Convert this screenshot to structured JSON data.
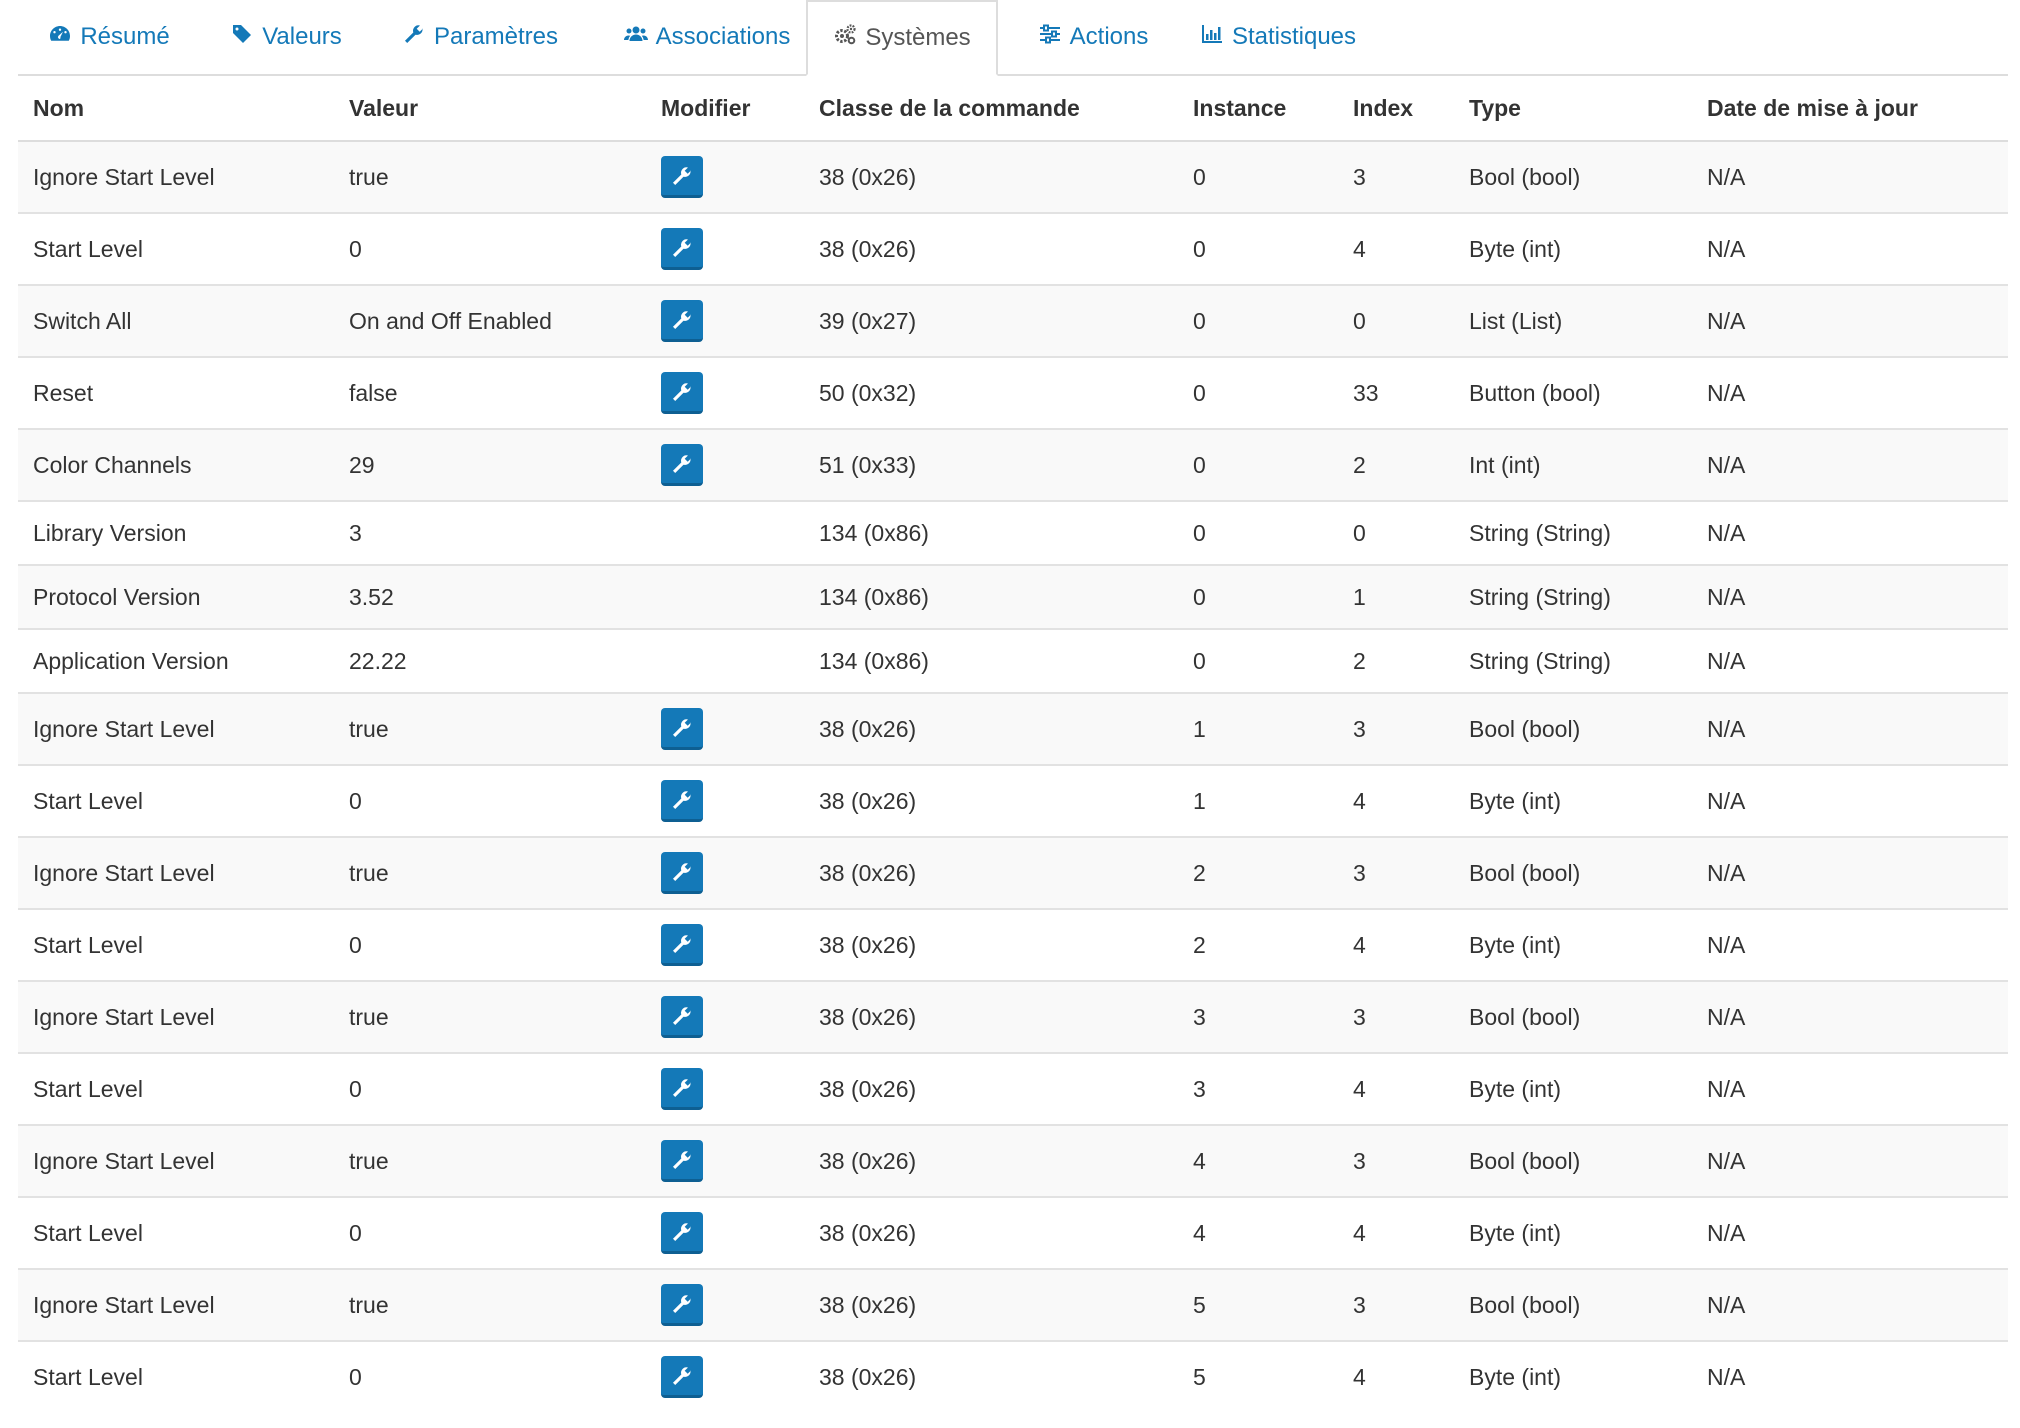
{
  "tabs": [
    {
      "label": "Résumé",
      "icon": "dashboard-icon"
    },
    {
      "label": "Valeurs",
      "icon": "tag-icon"
    },
    {
      "label": "Paramètres",
      "icon": "wrench-icon"
    },
    {
      "label": "Associations",
      "icon": "users-icon"
    },
    {
      "label": "Systèmes",
      "icon": "gears-icon",
      "active": true
    },
    {
      "label": "Actions",
      "icon": "sliders-icon"
    },
    {
      "label": "Statistiques",
      "icon": "bar-chart-icon"
    }
  ],
  "table": {
    "headers": [
      "Nom",
      "Valeur",
      "Modifier",
      "Classe de la commande",
      "Instance",
      "Index",
      "Type",
      "Date de mise à jour"
    ],
    "rows": [
      {
        "name": "Ignore Start Level",
        "value": "true",
        "editable": true,
        "cmd_class": "38 (0x26)",
        "instance": "0",
        "index": "3",
        "type": "Bool (bool)",
        "updated": "N/A"
      },
      {
        "name": "Start Level",
        "value": "0",
        "editable": true,
        "cmd_class": "38 (0x26)",
        "instance": "0",
        "index": "4",
        "type": "Byte (int)",
        "updated": "N/A"
      },
      {
        "name": "Switch All",
        "value": "On and Off Enabled",
        "editable": true,
        "cmd_class": "39 (0x27)",
        "instance": "0",
        "index": "0",
        "type": "List (List)",
        "updated": "N/A"
      },
      {
        "name": "Reset",
        "value": "false",
        "editable": true,
        "cmd_class": "50 (0x32)",
        "instance": "0",
        "index": "33",
        "type": "Button (bool)",
        "updated": "N/A"
      },
      {
        "name": "Color Channels",
        "value": "29",
        "editable": true,
        "cmd_class": "51 (0x33)",
        "instance": "0",
        "index": "2",
        "type": "Int (int)",
        "updated": "N/A"
      },
      {
        "name": "Library Version",
        "value": "3",
        "editable": false,
        "cmd_class": "134 (0x86)",
        "instance": "0",
        "index": "0",
        "type": "String (String)",
        "updated": "N/A"
      },
      {
        "name": "Protocol Version",
        "value": "3.52",
        "editable": false,
        "cmd_class": "134 (0x86)",
        "instance": "0",
        "index": "1",
        "type": "String (String)",
        "updated": "N/A"
      },
      {
        "name": "Application Version",
        "value": "22.22",
        "editable": false,
        "cmd_class": "134 (0x86)",
        "instance": "0",
        "index": "2",
        "type": "String (String)",
        "updated": "N/A"
      },
      {
        "name": "Ignore Start Level",
        "value": "true",
        "editable": true,
        "cmd_class": "38 (0x26)",
        "instance": "1",
        "index": "3",
        "type": "Bool (bool)",
        "updated": "N/A"
      },
      {
        "name": "Start Level",
        "value": "0",
        "editable": true,
        "cmd_class": "38 (0x26)",
        "instance": "1",
        "index": "4",
        "type": "Byte (int)",
        "updated": "N/A"
      },
      {
        "name": "Ignore Start Level",
        "value": "true",
        "editable": true,
        "cmd_class": "38 (0x26)",
        "instance": "2",
        "index": "3",
        "type": "Bool (bool)",
        "updated": "N/A"
      },
      {
        "name": "Start Level",
        "value": "0",
        "editable": true,
        "cmd_class": "38 (0x26)",
        "instance": "2",
        "index": "4",
        "type": "Byte (int)",
        "updated": "N/A"
      },
      {
        "name": "Ignore Start Level",
        "value": "true",
        "editable": true,
        "cmd_class": "38 (0x26)",
        "instance": "3",
        "index": "3",
        "type": "Bool (bool)",
        "updated": "N/A"
      },
      {
        "name": "Start Level",
        "value": "0",
        "editable": true,
        "cmd_class": "38 (0x26)",
        "instance": "3",
        "index": "4",
        "type": "Byte (int)",
        "updated": "N/A"
      },
      {
        "name": "Ignore Start Level",
        "value": "true",
        "editable": true,
        "cmd_class": "38 (0x26)",
        "instance": "4",
        "index": "3",
        "type": "Bool (bool)",
        "updated": "N/A"
      },
      {
        "name": "Start Level",
        "value": "0",
        "editable": true,
        "cmd_class": "38 (0x26)",
        "instance": "4",
        "index": "4",
        "type": "Byte (int)",
        "updated": "N/A"
      },
      {
        "name": "Ignore Start Level",
        "value": "true",
        "editable": true,
        "cmd_class": "38 (0x26)",
        "instance": "5",
        "index": "3",
        "type": "Bool (bool)",
        "updated": "N/A"
      },
      {
        "name": "Start Level",
        "value": "0",
        "editable": true,
        "cmd_class": "38 (0x26)",
        "instance": "5",
        "index": "4",
        "type": "Byte (int)",
        "updated": "N/A"
      }
    ]
  },
  "colors": {
    "accent": "#1479b8",
    "border": "#dddddd",
    "stripe": "#f9f9f9"
  }
}
